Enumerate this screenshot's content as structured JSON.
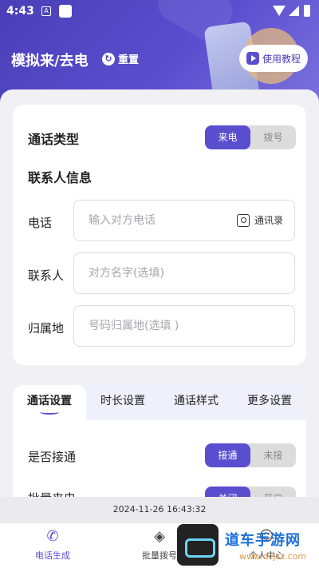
{
  "status_bar": {
    "time": "4:43",
    "notif_letter": "A"
  },
  "header": {
    "title": "模拟来/去电",
    "reset_label": "重置",
    "tutorial_label": "使用教程"
  },
  "call_type": {
    "label": "通话类型",
    "options": [
      "来电",
      "拨号"
    ],
    "selected": "来电"
  },
  "contact_info": {
    "title": "联系人信息",
    "phone": {
      "label": "电话",
      "placeholder": "输入对方电话",
      "contacts_label": "通讯录"
    },
    "name": {
      "label": "联系人",
      "placeholder": "对方名字(选填)"
    },
    "location": {
      "label": "归属地",
      "placeholder": "号码归属地(选填 )"
    }
  },
  "settings_tabs": [
    "通话设置",
    "时长设置",
    "通话样式",
    "更多设置"
  ],
  "active_tab": "通话设置",
  "answered": {
    "label": "是否接通",
    "options": [
      "接通",
      "未接"
    ],
    "selected": "接通"
  },
  "partial_row": {
    "label": "批量来电",
    "options": [
      "关闭",
      "开启"
    ]
  },
  "timestamp": "2024-11-26 16:43:32",
  "bottom_nav": [
    {
      "label": "电话生成",
      "icon": "phone-call-icon"
    },
    {
      "label": "批量拨号",
      "icon": "layers-icon"
    },
    {
      "label": "个人中心",
      "icon": "user-icon"
    }
  ],
  "watermark": {
    "text": "道车手游网",
    "sub": "www.dcjsz.com"
  },
  "colors": {
    "accent": "#5a4ecf",
    "header": "#4a3fb6"
  }
}
